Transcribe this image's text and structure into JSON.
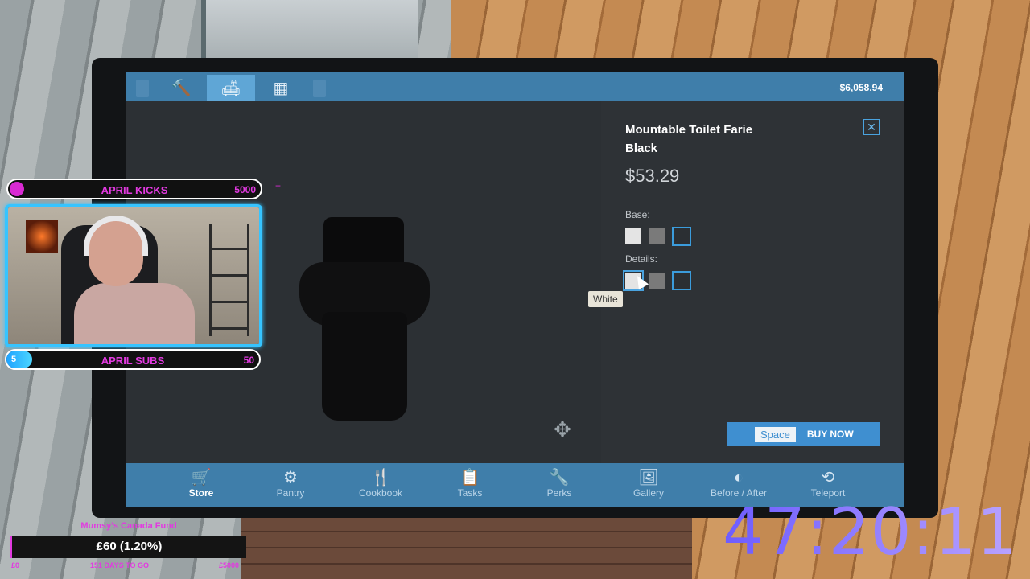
{
  "store": {
    "balance": "$6,058.94",
    "tabs": [
      {
        "icon": "hammer-icon",
        "glyph": "🔨"
      },
      {
        "icon": "sofa-icon",
        "glyph": "🛋"
      },
      {
        "icon": "fence-icon",
        "glyph": "▦"
      }
    ],
    "product": {
      "title": "Mountable Toilet Farie Black",
      "price": "$53.29",
      "base_label": "Base:",
      "details_label": "Details:",
      "tooltip": "White",
      "close_glyph": "✕"
    },
    "buy": {
      "key": "Space",
      "label": "BUY NOW"
    },
    "nav": [
      {
        "label": "Store",
        "glyph": "🛒"
      },
      {
        "label": "Pantry",
        "glyph": "⚙"
      },
      {
        "label": "Cookbook",
        "glyph": "🍴"
      },
      {
        "label": "Tasks",
        "glyph": "📋"
      },
      {
        "label": "Perks",
        "glyph": "🔧"
      },
      {
        "label": "Gallery",
        "glyph": "🖼"
      },
      {
        "label": "Before / After",
        "glyph": "◐"
      },
      {
        "label": "Teleport",
        "glyph": "⟲"
      }
    ],
    "move_glyph": "✥"
  },
  "overlay": {
    "kicks": {
      "left": "0",
      "title": "APRIL KICKS",
      "right": "5000"
    },
    "subs": {
      "left": "5",
      "title": "APRIL SUBS",
      "right": "50"
    },
    "fund": {
      "title": "Mumsy's Canada Fund",
      "value": "£60 (1.20%)",
      "foot_left": "£0",
      "foot_mid": "151 DAYS TO GO",
      "foot_right": "£5000"
    },
    "timer": "47:20:11",
    "plus": "+"
  }
}
